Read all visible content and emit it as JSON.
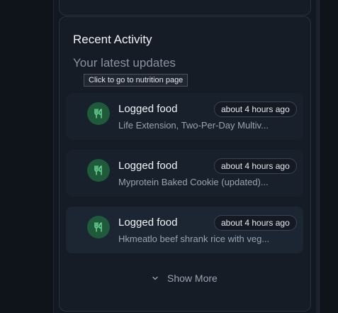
{
  "card": {
    "title": "Recent Activity",
    "subtitle": "Your latest updates",
    "tooltip": "Click to go to nutrition page"
  },
  "activities": [
    {
      "icon": "utensils-icon",
      "title": "Logged food",
      "time": "about 4 hours ago",
      "description": "Life Extension, Two-Per-Day Multiv..."
    },
    {
      "icon": "utensils-icon",
      "title": "Logged food",
      "time": "about 4 hours ago",
      "description": "Myprotein Baked Cookie (updated)..."
    },
    {
      "icon": "utensils-icon",
      "title": "Logged food",
      "time": "about 4 hours ago",
      "description": "Hkmeatlo beef shrank rice with veg..."
    }
  ],
  "show_more": {
    "label": "Show More",
    "icon": "chevron-down-icon"
  },
  "colors": {
    "icon_bg": "#1f5a3a",
    "icon_fg": "#6fdc9c"
  }
}
